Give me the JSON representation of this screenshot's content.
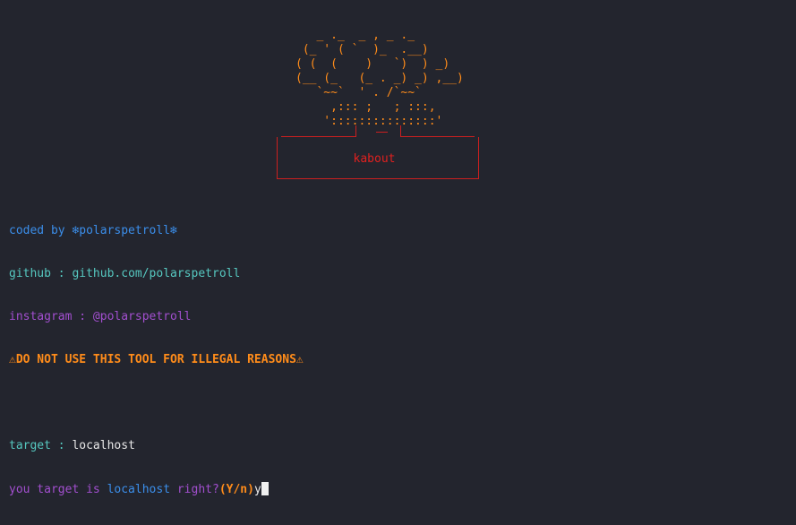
{
  "banner": {
    "art_lines": [
      "   _ ._  _ , _ ._",
      " (_ ' ( `  )_  .__)",
      "( (  (    )   `)  ) _)",
      "(__ (_   (_ . _) _) ,__)",
      "   `~~`  ' . /`~~`",
      "     ,::: ;   ; :::,",
      "    ':::::::::::::::'"
    ],
    "name": "kabout",
    "colors": {
      "art": "#ff8c1a",
      "box": "#cc1f1f",
      "name": "#e0201f"
    }
  },
  "info": {
    "coded_by": "coded by ❄polarspetroll❄",
    "github_label": "github : ",
    "github_value": "github.com/polarspetroll",
    "instagram": "instagram : @polarspetroll",
    "warning": "⚠DO NOT USE THIS TOOL FOR ILLEGAL REASONS⚠"
  },
  "prompt": {
    "target_label": "target : ",
    "target_value": "localhost",
    "confirm_prefix": "you target is ",
    "confirm_host": "localhost",
    "confirm_suffix": " right?",
    "confirm_options": "(Y/n)",
    "input_value": "y"
  },
  "colors": {
    "background": "#23252e",
    "blue": "#3b8eea",
    "teal": "#56c8c0",
    "purple": "#a24fcf",
    "orange": "#ff8c1a"
  }
}
